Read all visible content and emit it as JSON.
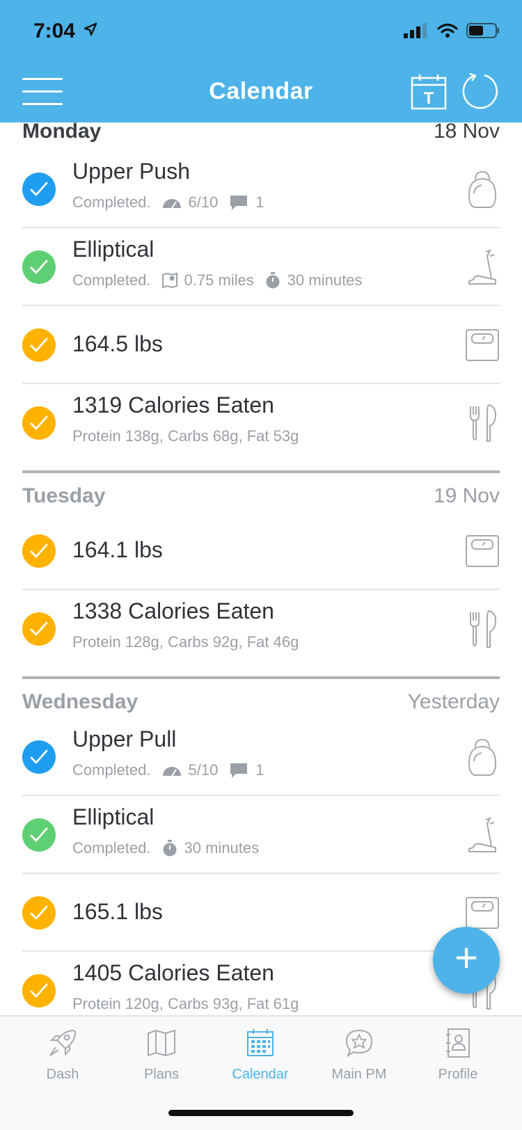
{
  "status": {
    "time": "7:04"
  },
  "header": {
    "title": "Calendar",
    "today_label": "T"
  },
  "colors": {
    "accent": "#4db3e8",
    "workout": "#1f9df0",
    "cardio": "#5fcf74",
    "tracked": "#ffb300"
  },
  "days": [
    {
      "name": "Monday",
      "date": "18 Nov",
      "items": [
        {
          "title": "Upper Push",
          "status": "Completed.",
          "rpe": "6/10",
          "comments": "1",
          "icon": "kettlebell-icon"
        },
        {
          "title": "Elliptical",
          "status": "Completed.",
          "distance": "0.75 miles",
          "duration": "30 minutes",
          "icon": "elliptical-icon"
        },
        {
          "title": "164.5 lbs",
          "icon": "scale-icon"
        },
        {
          "title": "1319 Calories Eaten",
          "macros": "Protein 138g, Carbs 68g, Fat 53g",
          "icon": "fork-knife-icon"
        }
      ]
    },
    {
      "name": "Tuesday",
      "date": "19 Nov",
      "items": [
        {
          "title": "164.1 lbs",
          "icon": "scale-icon"
        },
        {
          "title": "1338 Calories Eaten",
          "macros": "Protein 128g, Carbs 92g, Fat 46g",
          "icon": "fork-knife-icon"
        }
      ]
    },
    {
      "name": "Wednesday",
      "date": "Yesterday",
      "items": [
        {
          "title": "Upper Pull",
          "status": "Completed.",
          "rpe": "5/10",
          "comments": "1",
          "icon": "kettlebell-icon"
        },
        {
          "title": "Elliptical",
          "status": "Completed.",
          "duration": "30 minutes",
          "icon": "elliptical-icon"
        },
        {
          "title": "165.1 lbs",
          "icon": "scale-icon"
        },
        {
          "title": "1405 Calories Eaten",
          "macros": "Protein 120g, Carbs 93g, Fat 61g",
          "icon": "fork-knife-icon"
        }
      ]
    }
  ],
  "fab": {
    "label": "+"
  },
  "tabs": [
    {
      "label": "Dash",
      "icon": "rocket-icon"
    },
    {
      "label": "Plans",
      "icon": "map-icon"
    },
    {
      "label": "Calendar",
      "icon": "calendar-icon",
      "active": true
    },
    {
      "label": "Main PM",
      "icon": "chat-star-icon"
    },
    {
      "label": "Profile",
      "icon": "contact-book-icon"
    }
  ]
}
